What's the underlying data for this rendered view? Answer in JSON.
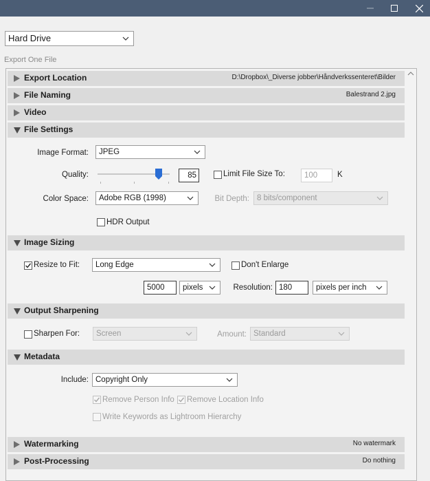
{
  "window": {
    "minimize": "minimize",
    "maximize": "maximize",
    "close": "close"
  },
  "destination": {
    "selected": "Hard Drive"
  },
  "export_label": "Export One File",
  "sections": {
    "export_location": {
      "title": "Export Location",
      "summary": "D:\\Dropbox\\_Diverse jobber\\Håndverkssenteret\\Bilder",
      "expanded": false
    },
    "file_naming": {
      "title": "File Naming",
      "summary": "Balestrand 2.jpg",
      "expanded": false
    },
    "video": {
      "title": "Video",
      "summary": "",
      "expanded": false
    },
    "file_settings": {
      "title": "File Settings",
      "expanded": true
    },
    "image_sizing": {
      "title": "Image Sizing",
      "expanded": true
    },
    "output_sharpening": {
      "title": "Output Sharpening",
      "expanded": true
    },
    "metadata": {
      "title": "Metadata",
      "expanded": true
    },
    "watermarking": {
      "title": "Watermarking",
      "summary": "No watermark",
      "expanded": false
    },
    "post_processing": {
      "title": "Post-Processing",
      "summary": "Do nothing",
      "expanded": false
    }
  },
  "file_settings": {
    "image_format_label": "Image Format:",
    "image_format": "JPEG",
    "quality_label": "Quality:",
    "quality": "85",
    "quality_fraction": 0.85,
    "limit_size_label": "Limit File Size To:",
    "limit_size_checked": false,
    "limit_size_value": "100",
    "limit_size_unit": "K",
    "color_space_label": "Color Space:",
    "color_space": "Adobe RGB (1998)",
    "bit_depth_label": "Bit Depth:",
    "bit_depth": "8 bits/component",
    "hdr_label": "HDR Output",
    "hdr_checked": false
  },
  "image_sizing": {
    "resize_label": "Resize to Fit:",
    "resize_checked": true,
    "resize_mode": "Long Edge",
    "dont_enlarge_label": "Don't Enlarge",
    "dont_enlarge_checked": false,
    "size_value": "5000",
    "size_unit": "pixels",
    "resolution_label": "Resolution:",
    "resolution_value": "180",
    "resolution_unit": "pixels per inch"
  },
  "output_sharpening": {
    "sharpen_label": "Sharpen For:",
    "sharpen_checked": false,
    "sharpen_for": "Screen",
    "amount_label": "Amount:",
    "amount": "Standard"
  },
  "metadata": {
    "include_label": "Include:",
    "include": "Copyright Only",
    "remove_person_label": "Remove Person Info",
    "remove_person_checked": true,
    "remove_location_label": "Remove Location Info",
    "remove_location_checked": true,
    "keywords_label": "Write Keywords as Lightroom Hierarchy",
    "keywords_checked": false
  }
}
